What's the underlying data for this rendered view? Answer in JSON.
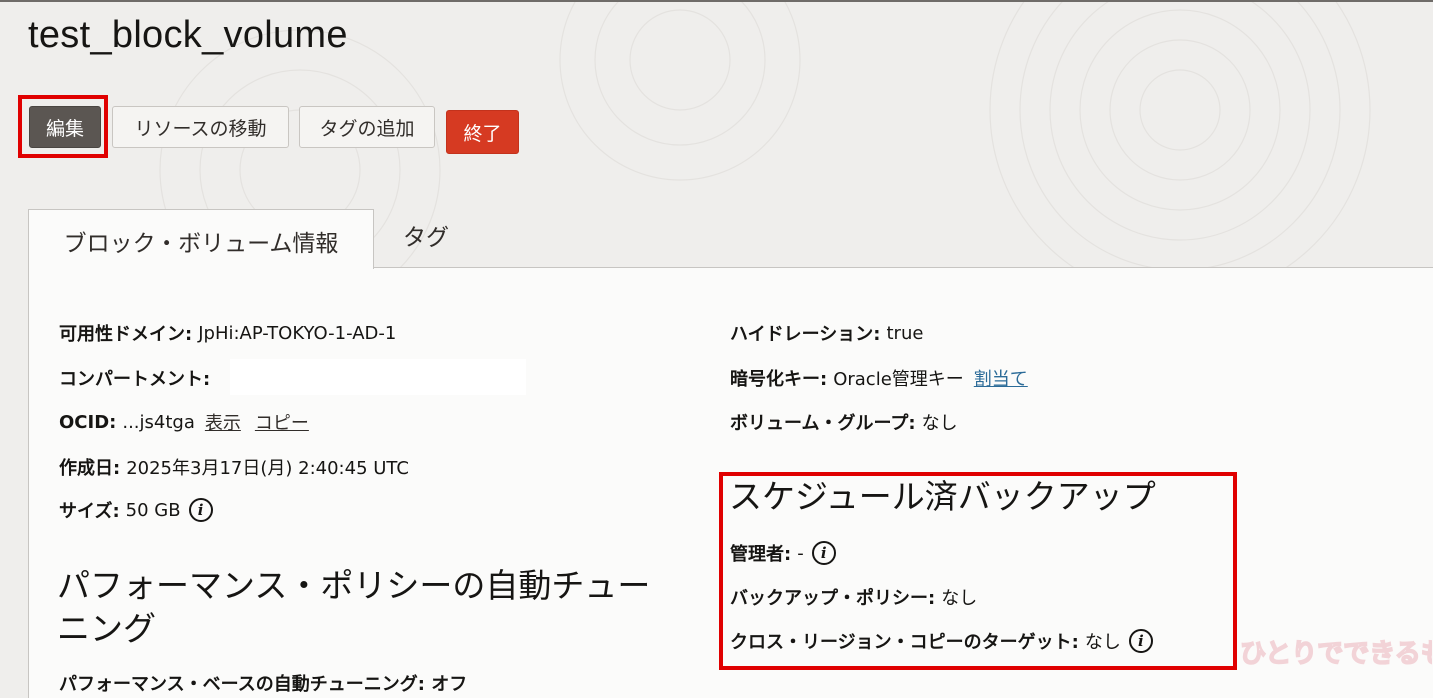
{
  "page": {
    "title": "test_block_volume"
  },
  "actions": {
    "edit": "編集",
    "move_resource": "リソースの移動",
    "add_tag": "タグの追加",
    "terminate": "終了"
  },
  "tabs": [
    {
      "label": "ブロック・ボリューム情報",
      "active": true
    },
    {
      "label": "タグ",
      "active": false
    }
  ],
  "details_left": {
    "availability_domain": {
      "label": "可用性ドメイン:",
      "value": "JpHi:AP-TOKYO-1-AD-1"
    },
    "compartment": {
      "label": "コンパートメント:",
      "value": ""
    },
    "ocid": {
      "label": "OCID:",
      "value": "...js4tga",
      "show_link": "表示",
      "copy_link": "コピー"
    },
    "created": {
      "label": "作成日:",
      "value": "2025年3月17日(月) 2:40:45 UTC"
    },
    "size": {
      "label": "サイズ:",
      "value": "50 GB"
    }
  },
  "details_right": {
    "hydration": {
      "label": "ハイドレーション:",
      "value": "true"
    },
    "encryption_key": {
      "label": "暗号化キー:",
      "value": "Oracle管理キー",
      "assign_link": "割当て"
    },
    "volume_group": {
      "label": "ボリューム・グループ:",
      "value": "なし"
    }
  },
  "performance_section": {
    "heading_line1": "パフォーマンス・ポリシーの自動チュー",
    "heading_line2": "ニング",
    "cut_row": "パフォーマンス・ベースの自動チューニング: オフ"
  },
  "scheduled_backups": {
    "heading": "スケジュール済バックアップ",
    "administrator": {
      "label": "管理者:",
      "value": "-"
    },
    "backup_policy": {
      "label": "バックアップ・ポリシー:",
      "value": "なし"
    },
    "cross_region_target": {
      "label": "クロス・リージョン・コピーのターゲット:",
      "value": "なし"
    }
  },
  "watermark": {
    "text": "ひとりでできるもん"
  },
  "colors": {
    "highlight": "#e00000",
    "terminate_bg": "#d63a22",
    "edit_bg": "#5b5652",
    "link_blue": "#2b6b98"
  },
  "icons": [
    "info-icon"
  ]
}
